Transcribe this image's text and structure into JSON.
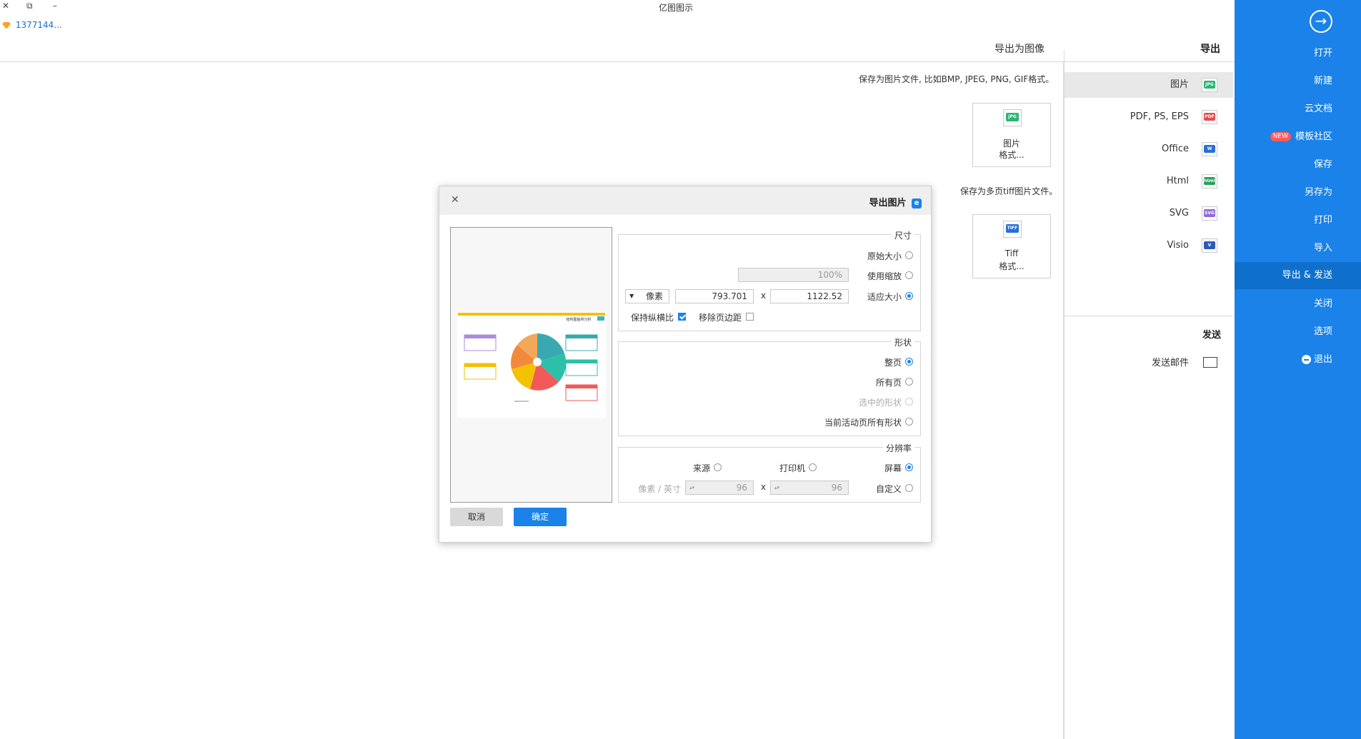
{
  "window": {
    "title": "亿图图示",
    "controls": {
      "close": "✕",
      "restore": "⧉",
      "minimize": "–"
    },
    "user": "1377144..."
  },
  "sidebar": {
    "items": [
      {
        "label": "打开"
      },
      {
        "label": "新建"
      },
      {
        "label": "云文档"
      },
      {
        "label": "模板社区",
        "badge": "NEW"
      },
      {
        "label": "保存"
      },
      {
        "label": "另存为"
      },
      {
        "label": "打印"
      },
      {
        "label": "导入"
      },
      {
        "label": "导出 & 发送"
      },
      {
        "label": "关闭"
      },
      {
        "label": "选项"
      },
      {
        "label": "退出"
      }
    ]
  },
  "export_section": {
    "heading": "导出",
    "types": [
      {
        "label": "图片",
        "icon_text": "JPG",
        "icon_color": "#2bb673"
      },
      {
        "label": "PDF, PS, EPS",
        "icon_text": "PDF",
        "icon_color": "#e84c4c"
      },
      {
        "label": "Office",
        "icon_text": "W",
        "icon_color": "#2b6fd6"
      },
      {
        "label": "Html",
        "icon_text": "html",
        "icon_color": "#27a35a"
      },
      {
        "label": "SVG",
        "icon_text": "SVG",
        "icon_color": "#8e6bd8"
      },
      {
        "label": "Visio",
        "icon_text": "V",
        "icon_color": "#2b5cb8"
      }
    ],
    "send_heading": "发送",
    "send_mail": "发送邮件"
  },
  "detail": {
    "title": "导出为图像",
    "desc1": "保存为图片文件, 比如BMP, JPEG, PNG, GIF格式。",
    "card1": {
      "line1": "图片",
      "line2": "格式...",
      "icon_text": "JPG"
    },
    "desc2": "保存为多页tiff图片文件。",
    "card2": {
      "line1": "Tiff",
      "line2": "格式...",
      "icon_text": "TIFF"
    }
  },
  "dialog": {
    "title": "导出图片",
    "size_group": {
      "title": "尺寸",
      "original": "原始大小",
      "use_zoom": "使用缩放",
      "zoom_value": "100%",
      "fit": "适应大小",
      "width": "1122.52",
      "height": "793.701",
      "unit": "像素",
      "times": "x",
      "remove_margin": "移除页边距",
      "keep_ratio": "保持纵横比"
    },
    "shape_group": {
      "title": "形状",
      "whole_page": "整页",
      "all_pages": "所有页",
      "selected": "选中的形状",
      "current_page": "当前活动页所有形状"
    },
    "res_group": {
      "title": "分辨率",
      "screen": "屏幕",
      "printer": "打印机",
      "source": "来源",
      "custom": "自定义",
      "res_x": "96",
      "res_y": "96",
      "unit": "像素 / 英寸",
      "times": "x"
    },
    "ok": "确定",
    "cancel": "取消",
    "preview": {
      "title": "结构图鱼骨分析",
      "footer": "xxxxxxxxxx"
    }
  }
}
